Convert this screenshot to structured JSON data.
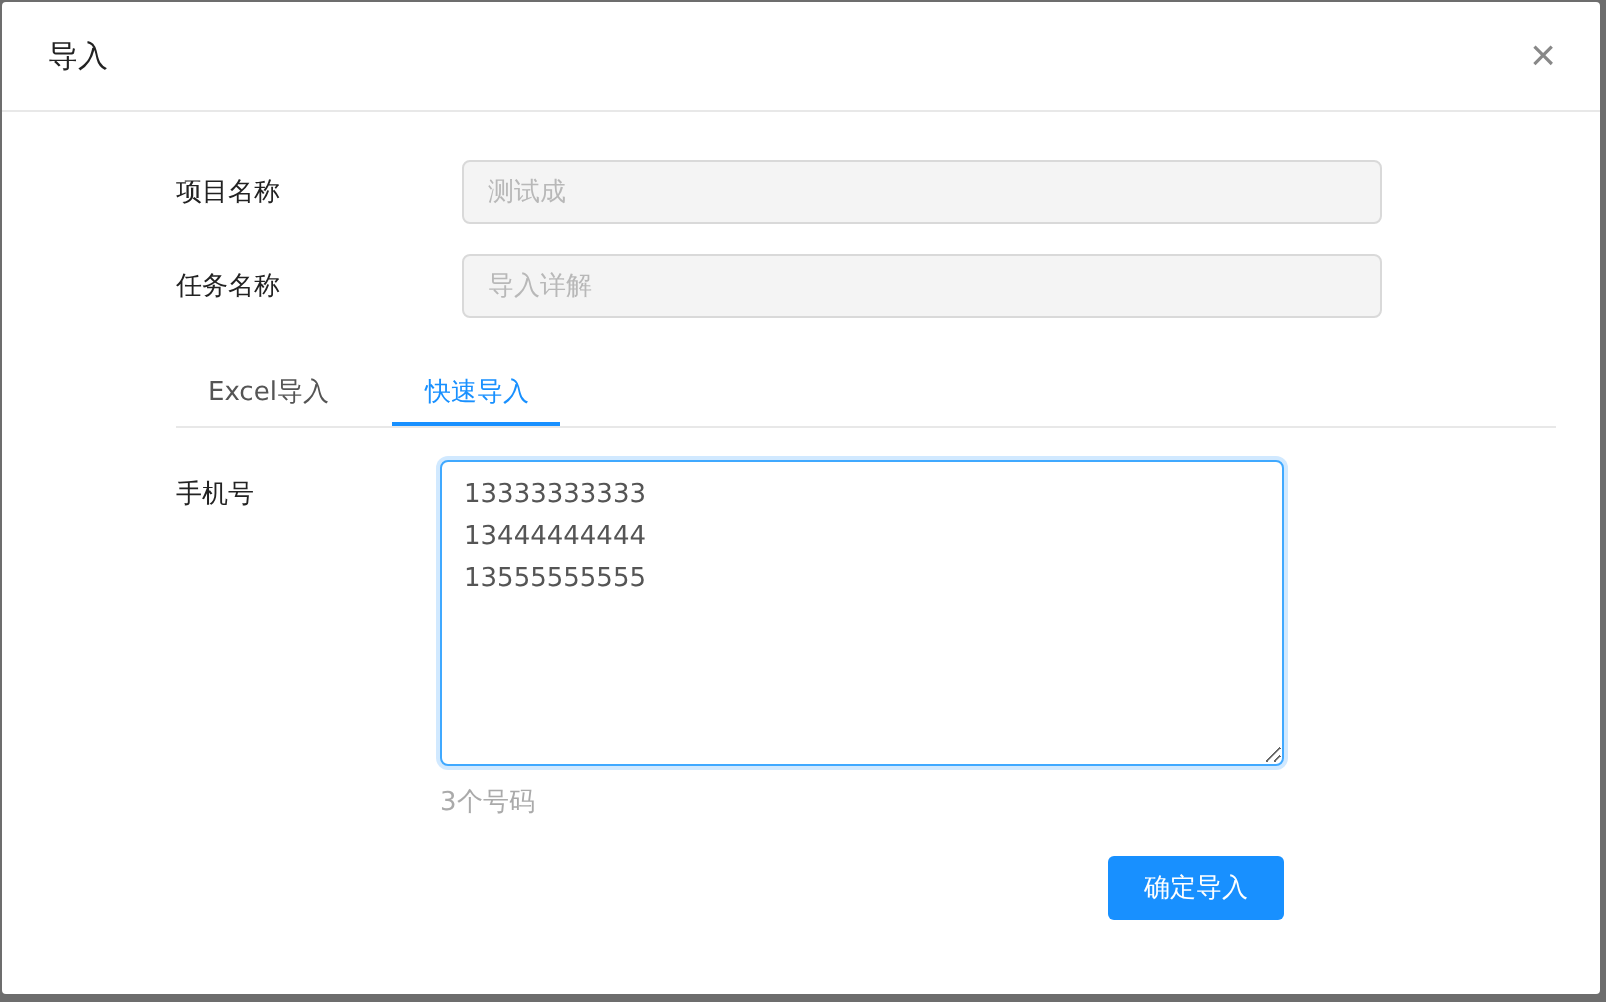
{
  "dialog": {
    "title": "导入",
    "close": "×"
  },
  "fields": [
    {
      "label": "项目名称",
      "placeholder": "测试成",
      "disabled": true
    },
    {
      "label": "任务名称",
      "placeholder": "导入详解",
      "disabled": true
    }
  ],
  "tabs": [
    {
      "label": "Excel导入",
      "selected": false
    },
    {
      "label": "快速导入",
      "selected": true
    }
  ],
  "phone": {
    "label": "手机号",
    "value": "13333333333\n13444444444\n13555555555",
    "count": "3个号码"
  },
  "submit": "确定导入"
}
